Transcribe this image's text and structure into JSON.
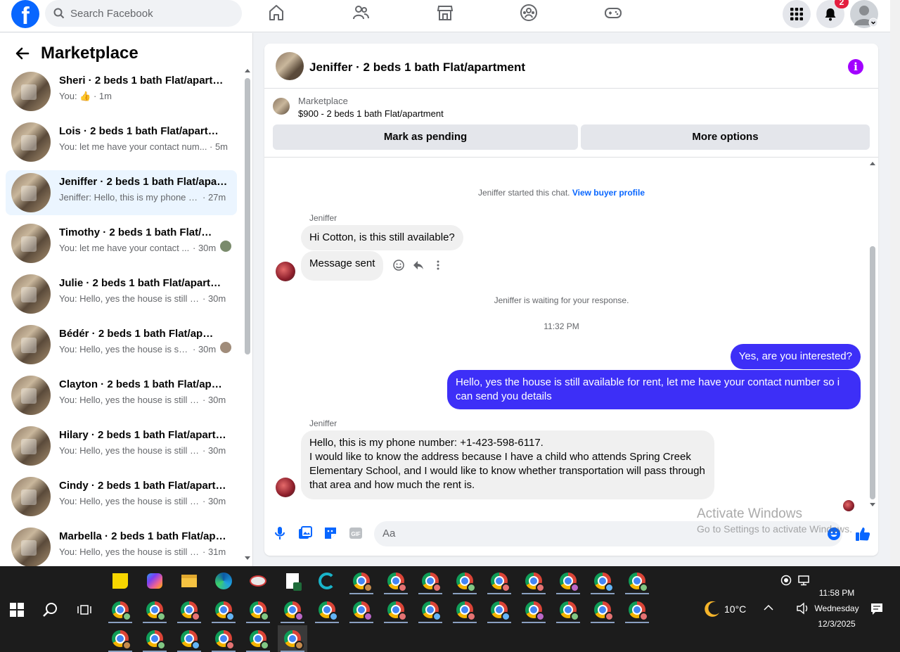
{
  "header": {
    "logo": "f",
    "search_placeholder": "Search Facebook",
    "notification_count": "2",
    "icons": [
      "home-icon",
      "friends-icon",
      "marketplace-icon",
      "groups-icon",
      "gaming-icon",
      "menu-grid-icon",
      "bell-icon",
      "account-icon"
    ]
  },
  "sidebar": {
    "title": "Marketplace",
    "conversations": [
      {
        "title": "Sheri · 2 beds 1 bath Flat/apartment",
        "preview": "You: 👍 · 1m",
        "time": ""
      },
      {
        "title": "Lois · 2 beds 1 bath Flat/apartment",
        "preview": "You: let me have your contact num...",
        "time": "· 5m"
      },
      {
        "title": "Jeniffer · 2 beds 1 bath Flat/apartment",
        "preview": "Jeniffer: Hello, this is my phone n...",
        "time": "· 27m"
      },
      {
        "title": "Timothy · 2 beds 1 bath Flat/apartment",
        "preview": "You: let me have your contact ...",
        "time": "· 30m"
      },
      {
        "title": "Julie · 2 beds 1 bath Flat/apartment",
        "preview": "You: Hello, yes the house is still a...",
        "time": "· 30m"
      },
      {
        "title": "Bédér · 2 beds 1 bath Flat/apartment",
        "preview": "You: Hello, yes the house is stil...",
        "time": "· 30m"
      },
      {
        "title": "Clayton · 2 beds 1 bath Flat/apartment",
        "preview": "You: Hello, yes the house is still a...",
        "time": "· 30m"
      },
      {
        "title": "Hilary · 2 beds 1 bath Flat/apartment",
        "preview": "You: Hello, yes the house is still a...",
        "time": "· 30m"
      },
      {
        "title": "Cindy · 2 beds 1 bath Flat/apartment",
        "preview": "You: Hello, yes the house is still a...",
        "time": "· 30m"
      },
      {
        "title": "Marbella · 2 beds 1 bath Flat/apartment",
        "preview": "You: Hello, yes the house is still a...",
        "time": "· 31m"
      }
    ]
  },
  "chat": {
    "title": "Jeniffer · 2 beds 1 bath Flat/apartment",
    "listing_label": "Marketplace",
    "listing_text": "$900 - 2 beds 1 bath Flat/apartment",
    "mark_pending": "Mark as pending",
    "more_options": "More options",
    "started": "Jeniffer started this chat.",
    "view_profile": "View buyer profile",
    "sender_name": "Jeniffer",
    "msg1": "Hi Cotton, is this still available?",
    "msg2": "Message sent",
    "waiting": "Jeniffer is waiting for your response.",
    "timestamp": "11:32 PM",
    "reply1": "Yes, are you interested?",
    "reply2": "Hello, yes the house is still available for rent, let me have your contact number so i can send you details",
    "msg3": "Hello, this is my phone number: +1-423-598-6117.\nI would like to know the address because I have a child who attends Spring Creek Elementary School, and I would like to know whether transportation will pass through that area and how much the rent is.",
    "composer_placeholder": "Aa"
  },
  "watermark": {
    "line1": "Activate Windows",
    "line2": "Go to Settings to activate Windows."
  },
  "taskbar": {
    "weather": "10°C",
    "time": "11:58 PM",
    "day": "Wednesday",
    "date": "12/3/2025"
  },
  "colors": {
    "brand": "#0866ff",
    "my_bubble": "#3d2ff7",
    "info": "#a200ff"
  }
}
